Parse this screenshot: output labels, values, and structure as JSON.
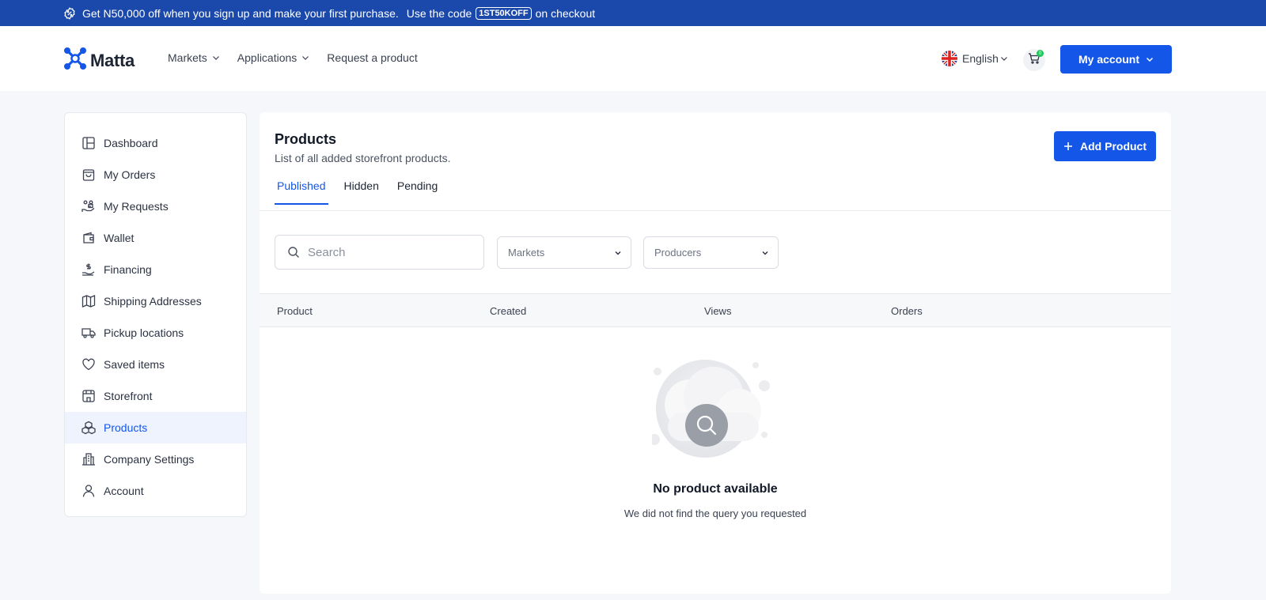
{
  "promo": {
    "text_before": "Get N50,000 off when you sign up and make your first purchase.",
    "text_code_intro": "Use the code",
    "code": "1ST50KOFF",
    "text_after": "on checkout"
  },
  "header": {
    "logo_text": "Matta",
    "nav": [
      {
        "label": "Markets"
      },
      {
        "label": "Applications"
      },
      {
        "label": "Request a product"
      }
    ],
    "language": "English",
    "cart_count": "0",
    "account_button": "My account"
  },
  "sidebar": {
    "items": [
      {
        "label": "Dashboard",
        "icon": "dashboard-icon"
      },
      {
        "label": "My Orders",
        "icon": "shopping-bag-icon"
      },
      {
        "label": "My Requests",
        "icon": "requests-icon"
      },
      {
        "label": "Wallet",
        "icon": "wallet-icon"
      },
      {
        "label": "Financing",
        "icon": "financing-icon"
      },
      {
        "label": "Shipping Addresses",
        "icon": "map-icon"
      },
      {
        "label": "Pickup locations",
        "icon": "truck-icon"
      },
      {
        "label": "Saved items",
        "icon": "heart-icon"
      },
      {
        "label": "Storefront",
        "icon": "storefront-icon"
      },
      {
        "label": "Products",
        "icon": "boxes-icon"
      },
      {
        "label": "Company Settings",
        "icon": "building-icon"
      },
      {
        "label": "Account",
        "icon": "user-icon"
      }
    ],
    "active": "Products"
  },
  "main": {
    "title": "Products",
    "subtitle": "List of all added storefront products.",
    "add_button": "Add Product",
    "tabs": [
      {
        "label": "Published"
      },
      {
        "label": "Hidden"
      },
      {
        "label": "Pending"
      }
    ],
    "active_tab": "Published",
    "search_placeholder": "Search",
    "filters": {
      "markets": "Markets",
      "producers": "Producers"
    },
    "columns": [
      "Product",
      "Created",
      "Views",
      "Orders"
    ],
    "empty": {
      "title": "No product available",
      "text": "We did not find the query you requested"
    }
  },
  "colors": {
    "primary": "#1356e8",
    "banner": "#1b49ab",
    "active_bg": "#eef3fd",
    "cart_badge": "#22c55e"
  }
}
